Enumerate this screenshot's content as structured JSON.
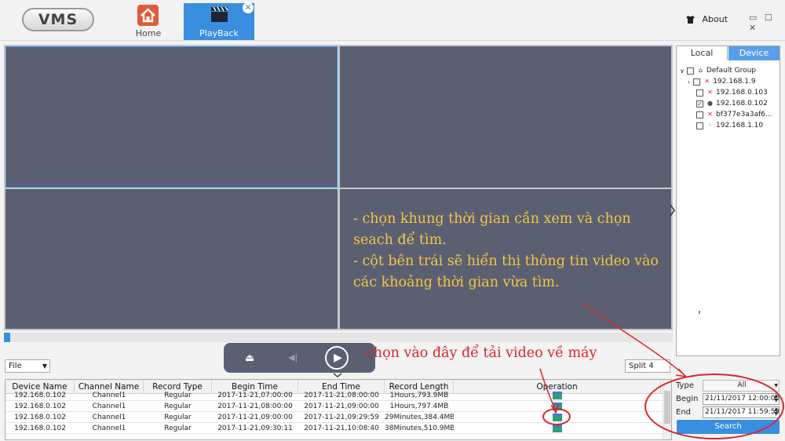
{
  "app": {
    "logo": "VMS"
  },
  "nav": {
    "home_label": "Home",
    "playback_label": "PlayBack",
    "close_glyph": "✕"
  },
  "topright": {
    "about_label": "About",
    "window_controls": "▭ ☐ ✕"
  },
  "annotations": {
    "instructions_line1": "- chọn khung thời gian cần xem và chọn seach để tìm.",
    "instructions_line2": "- cột bên trái sẽ hiển thị thông tin video vào các khoảng thời gian vừa tìm.",
    "download_hint": "chọn vào đây để tải video về máy",
    "colors": {
      "instructions": "#f5c542",
      "highlight": "#d8262e"
    }
  },
  "controls": {
    "file_select": "File",
    "split_select": "Split 4"
  },
  "table": {
    "headers": [
      "Device Name",
      "Channel Name",
      "Record Type",
      "Begin Time",
      "End Time",
      "Record Length",
      "Operation"
    ],
    "rows": [
      [
        "192.168.0.102",
        "Channel1",
        "Regular",
        "2017-11-21,07:00:00",
        "2017-11-21,08:00:00",
        "1Hours,793.9MB"
      ],
      [
        "192.168.0.102",
        "Channel1",
        "Regular",
        "2017-11-21,08:00:00",
        "2017-11-21,09:00:00",
        "1Hours,797.4MB"
      ],
      [
        "192.168.0.102",
        "Channel1",
        "Regular",
        "2017-11-21,09:00:00",
        "2017-11-21,09:29:59",
        "29Minutes,384.4MB"
      ],
      [
        "192.168.0.102",
        "Channel1",
        "Regular",
        "2017-11-21,09:30:11",
        "2017-11-21,10:08:40",
        "38Minutes,510.9MB"
      ]
    ],
    "operation_icon": "download-icon"
  },
  "panel": {
    "tab_local": "Local",
    "tab_device": "Device",
    "group_label": "Default Group",
    "devices": [
      {
        "label": "192.168.1.9",
        "checked": false,
        "status": "offline"
      },
      {
        "label": "192.168.0.103",
        "checked": false,
        "status": "offline"
      },
      {
        "label": "192.168.0.102",
        "checked": true,
        "status": "online"
      },
      {
        "label": "bf377e3a3af6...",
        "checked": false,
        "status": "offline"
      },
      {
        "label": "192.168.1.10",
        "checked": false,
        "status": "online"
      }
    ]
  },
  "search": {
    "type_label": "Type",
    "type_value": "All",
    "begin_label": "Begin",
    "begin_value": "21/11/2017 12:00:00",
    "end_label": "End",
    "end_value": "21/11/2017 11:59:59",
    "button_label": "Search"
  }
}
